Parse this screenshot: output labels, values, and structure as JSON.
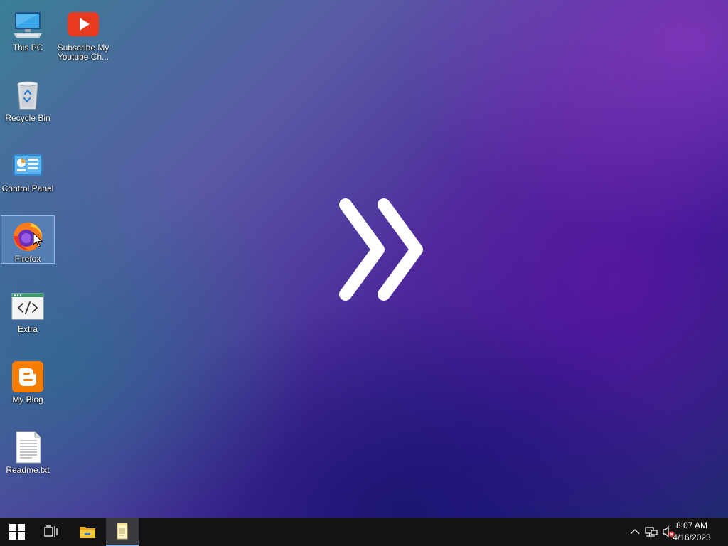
{
  "desktop": {
    "icons": [
      {
        "label": "This PC"
      },
      {
        "label": "Subscribe My\nYoutube Ch..."
      },
      {
        "label": "Recycle Bin"
      },
      {
        "label": "Control Panel"
      },
      {
        "label": "Firefox"
      },
      {
        "label": "Extra"
      },
      {
        "label": "My Blog"
      },
      {
        "label": "Readme.txt"
      }
    ],
    "selected_icon": "Firefox"
  },
  "taskbar": {
    "clock": {
      "time": "8:07 AM",
      "date": "4/16/2023"
    },
    "icons": [
      "windows-start-icon",
      "task-view-icon",
      "file-explorer-icon",
      "notepad-icon"
    ],
    "tray_icons": [
      "chevron-up-icon",
      "network-icon",
      "volume-muted-icon"
    ]
  },
  "colors": {
    "taskbar": "#141416",
    "selection": "#78aae6",
    "accent": "#8fb8e8"
  }
}
